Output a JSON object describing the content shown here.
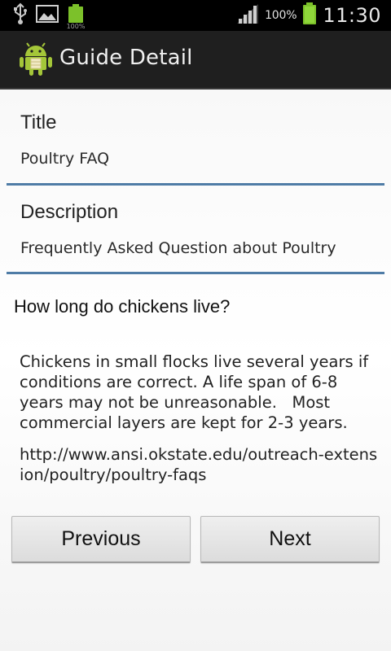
{
  "status_bar": {
    "battery_small_label": "100%",
    "battery_pct": "100%",
    "time": "11:30",
    "icons": [
      "usb-icon",
      "image-icon",
      "mini-battery-icon",
      "signal-icon",
      "battery-icon"
    ]
  },
  "action_bar": {
    "title": "Guide Detail",
    "icon": "android-app-icon"
  },
  "content": {
    "title_label": "Title",
    "title_value": "Poultry FAQ",
    "description_label": "Description",
    "description_value": "Frequently Asked Question about Poultry",
    "question": "How long do chickens live?",
    "answer": "Chickens in small flocks live several years if conditions are correct. A life span of 6-8 years may not be unreasonable.   Most commercial layers are kept for 2-3 years.",
    "link": "http://www.ansi.okstate.edu/outreach-extension/poultry/poultry-faqs"
  },
  "buttons": {
    "previous": "Previous",
    "next": "Next"
  },
  "colors": {
    "divider": "#4f7ca6",
    "action_bar": "#1f1f1f",
    "battery_green": "#7cc12a",
    "android_green": "#a4c639"
  }
}
